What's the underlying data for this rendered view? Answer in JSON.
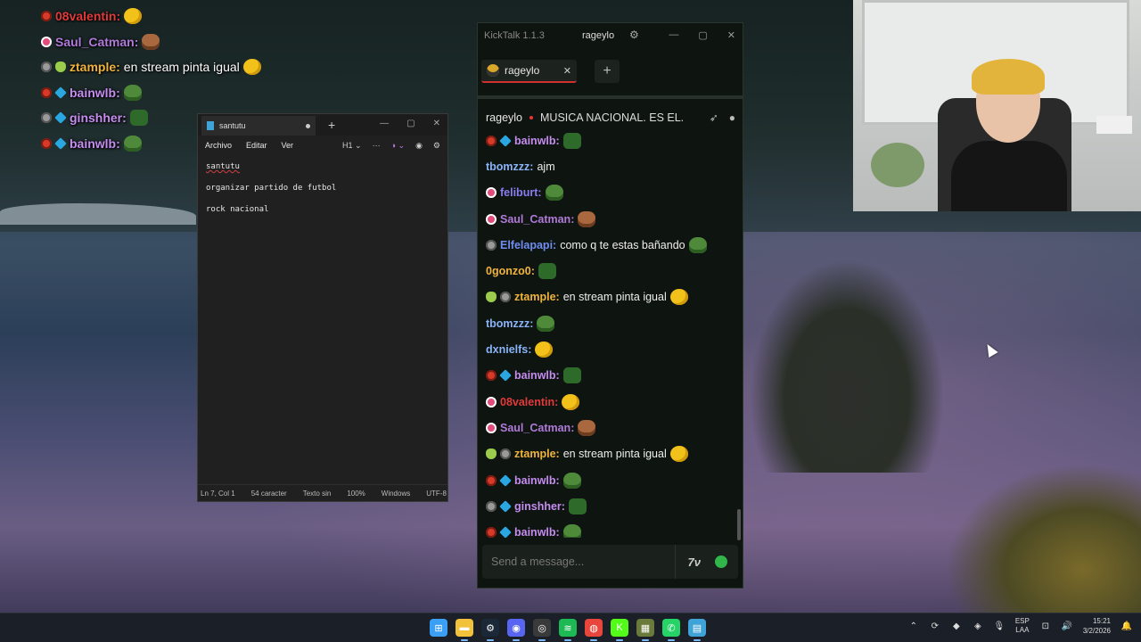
{
  "overlay_chat": [
    {
      "badges": [
        "red"
      ],
      "user": "08valentin",
      "color": "#e03a3a",
      "msg": "",
      "emote": "e-yellow"
    },
    {
      "badges": [
        "pink"
      ],
      "user": "Saul_Catman",
      "color": "#b07ad8",
      "msg": "",
      "emote": "e-cat"
    },
    {
      "badges": [
        "grey",
        "alien"
      ],
      "user": "ztample",
      "color": "#f0b43c",
      "msg": "en stream pinta igual",
      "emote": "e-yellow"
    },
    {
      "badges": [
        "red",
        "cube"
      ],
      "user": "bainwlb",
      "color": "#c58df0",
      "msg": "",
      "emote": "e-pepe"
    },
    {
      "badges": [
        "grey",
        "cube"
      ],
      "user": "ginshher",
      "color": "#c58df0",
      "msg": "",
      "emote": "e-pepe-dark"
    },
    {
      "badges": [
        "red",
        "cube"
      ],
      "user": "bainwlb",
      "color": "#c58df0",
      "msg": "",
      "emote": "e-pepe"
    }
  ],
  "notepad": {
    "tab_title": "santutu",
    "menu": [
      "Archivo",
      "Editar",
      "Ver"
    ],
    "heading_select": "H1",
    "lines": [
      "santutu",
      "organizar partido de futbol",
      "rock nacional"
    ],
    "status": [
      "Ln 7, Col 1",
      "54 caracter",
      "Texto sin",
      "100%",
      "Windows",
      "UTF-8"
    ]
  },
  "kicktalk": {
    "app_title": "KickTalk 1.1.3",
    "user": "rageylo",
    "tab_label": "rageylo",
    "channel": "rageylo",
    "stream_title": "MUSICA NACIONAL. ES EL...",
    "input_placeholder": "Send a message...",
    "messages": [
      {
        "badges": [
          "red",
          "cube"
        ],
        "user": "bainwlb",
        "color": "#c58df0",
        "msg": "",
        "emote": "e-pepe-dark"
      },
      {
        "badges": [],
        "user": "tbomzzz",
        "color": "#8ab4f8",
        "msg": "ajm",
        "emote": ""
      },
      {
        "badges": [
          "pink"
        ],
        "user": "feliburt",
        "color": "#8a7df0",
        "msg": "",
        "emote": "e-pepe"
      },
      {
        "badges": [
          "pink"
        ],
        "user": "Saul_Catman",
        "color": "#b07ad8",
        "msg": "",
        "emote": "e-cat"
      },
      {
        "badges": [
          "grey"
        ],
        "user": "Elfelapapi",
        "color": "#6f8df0",
        "msg": "como q te estas bañando",
        "emote": "e-pepe"
      },
      {
        "badges": [],
        "user": "0gonzo0",
        "color": "#f0b43c",
        "msg": "",
        "emote": "e-pepe-dark"
      },
      {
        "badges": [
          "alien",
          "grey"
        ],
        "user": "ztample",
        "color": "#f0b43c",
        "msg": "en stream pinta igual",
        "emote": "e-yellow"
      },
      {
        "badges": [],
        "user": "tbomzzz",
        "color": "#8ab4f8",
        "msg": "",
        "emote": "e-pepe"
      },
      {
        "badges": [],
        "user": "dxnielfs",
        "color": "#8ab4f8",
        "msg": "",
        "emote": "e-yellow"
      },
      {
        "badges": [
          "red",
          "cube"
        ],
        "user": "bainwlb",
        "color": "#c58df0",
        "msg": "",
        "emote": "e-pepe-dark"
      },
      {
        "badges": [
          "pink"
        ],
        "user": "08valentin",
        "color": "#e03a3a",
        "msg": "",
        "emote": "e-yellow"
      },
      {
        "badges": [
          "pink"
        ],
        "user": "Saul_Catman",
        "color": "#b07ad8",
        "msg": "",
        "emote": "e-cat"
      },
      {
        "badges": [
          "alien",
          "grey"
        ],
        "user": "ztample",
        "color": "#f0b43c",
        "msg": "en stream pinta igual",
        "emote": "e-yellow"
      },
      {
        "badges": [
          "red",
          "cube"
        ],
        "user": "bainwlb",
        "color": "#c58df0",
        "msg": "",
        "emote": "e-pepe"
      },
      {
        "badges": [
          "grey",
          "cube"
        ],
        "user": "ginshher",
        "color": "#c58df0",
        "msg": "",
        "emote": "e-pepe-dark"
      },
      {
        "badges": [
          "red",
          "cube"
        ],
        "user": "bainwlb",
        "color": "#c58df0",
        "msg": "",
        "emote": "e-pepe"
      }
    ]
  },
  "taskbar": {
    "apps": [
      {
        "name": "start-icon",
        "color": "#3a9ff5",
        "glyph": "⊞"
      },
      {
        "name": "file-explorer-icon",
        "color": "#f2c23a",
        "glyph": "▬"
      },
      {
        "name": "steam-icon",
        "color": "#1b2838",
        "glyph": "⚙"
      },
      {
        "name": "discord-icon",
        "color": "#5865f2",
        "glyph": "◉"
      },
      {
        "name": "obs-icon",
        "color": "#3a3a3a",
        "glyph": "◎"
      },
      {
        "name": "spotify-icon",
        "color": "#1db954",
        "glyph": "≋"
      },
      {
        "name": "chrome-icon",
        "color": "#e8453c",
        "glyph": "◍"
      },
      {
        "name": "kick-icon",
        "color": "#53fc18",
        "glyph": "K"
      },
      {
        "name": "game-icon",
        "color": "#6a7a3a",
        "glyph": "▦"
      },
      {
        "name": "whatsapp-icon",
        "color": "#25d366",
        "glyph": "✆"
      },
      {
        "name": "notepad-icon",
        "color": "#3fa3d8",
        "glyph": "▤"
      }
    ],
    "lang_line1": "ESP",
    "lang_line2": "LAA",
    "time": "15:21",
    "date": "3/2/2026"
  }
}
